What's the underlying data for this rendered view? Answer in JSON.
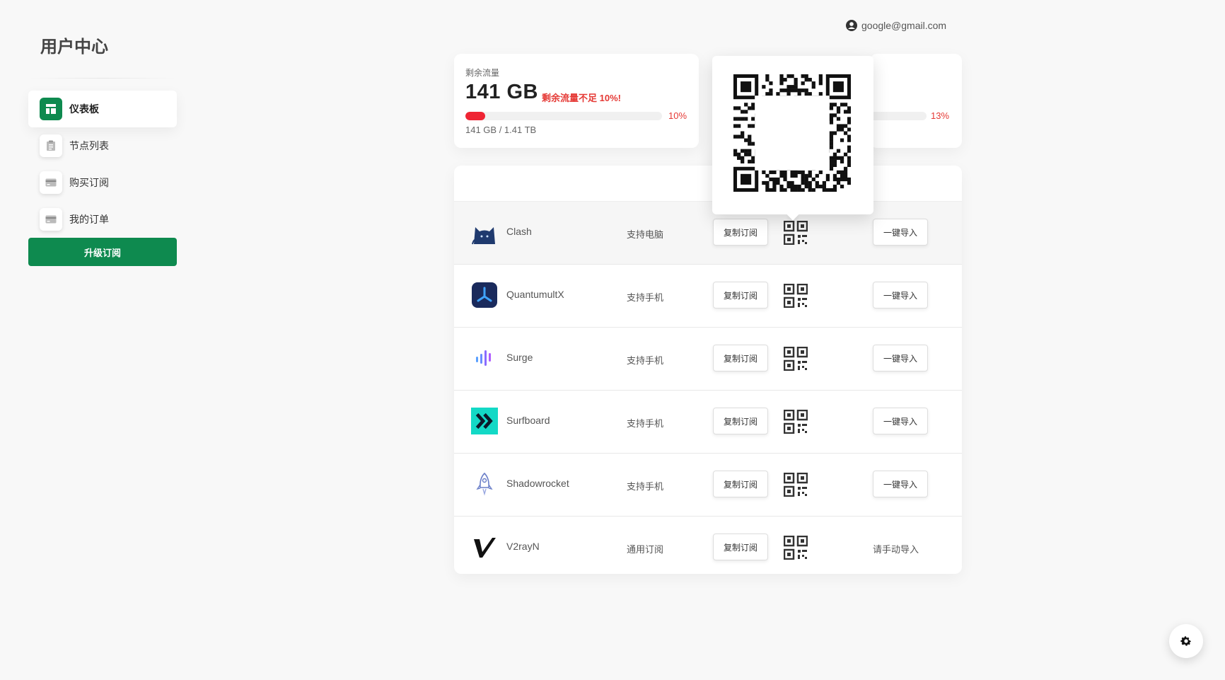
{
  "brand": {
    "title": "用户中心"
  },
  "user": {
    "email": "google@gmail.com",
    "icon": "user-circle-icon"
  },
  "sidebar": {
    "items": [
      {
        "label": "仪表板",
        "icon": "dashboard-icon",
        "active": true
      },
      {
        "label": "节点列表",
        "icon": "clipboard-icon",
        "active": false
      },
      {
        "label": "购买订阅",
        "icon": "credit-card-icon",
        "active": false
      },
      {
        "label": "我的订单",
        "icon": "credit-card-icon",
        "active": false
      }
    ],
    "upgrade_label": "升级订阅"
  },
  "traffic": {
    "label": "剩余流量",
    "value": "141 GB",
    "warning": "剩余流量不足 10%!",
    "percent": 10,
    "percent_label": "10%",
    "total": "141 GB / 1.41 TB"
  },
  "secondary_card": {
    "percent_label": "13%"
  },
  "clients": {
    "copy_label": "复制订阅",
    "import_label": "一键导入",
    "manual_label": "请手动导入",
    "rows": [
      {
        "name": "Clash",
        "support": "支持电脑",
        "logo": "clash-cat-icon",
        "import": true
      },
      {
        "name": "QuantumultX",
        "support": "支持手机",
        "logo": "quantumultx-icon",
        "import": true
      },
      {
        "name": "Surge",
        "support": "支持手机",
        "logo": "surge-icon",
        "import": true
      },
      {
        "name": "Surfboard",
        "support": "支持手机",
        "logo": "surfboard-icon",
        "import": true
      },
      {
        "name": "Shadowrocket",
        "support": "支持手机",
        "logo": "rocket-icon",
        "import": true
      },
      {
        "name": "V2rayN",
        "support": "通用订阅",
        "logo": "v2rayn-icon",
        "import": false
      }
    ]
  },
  "colors": {
    "accent": "#0e8a4f",
    "danger": "#e53935"
  }
}
